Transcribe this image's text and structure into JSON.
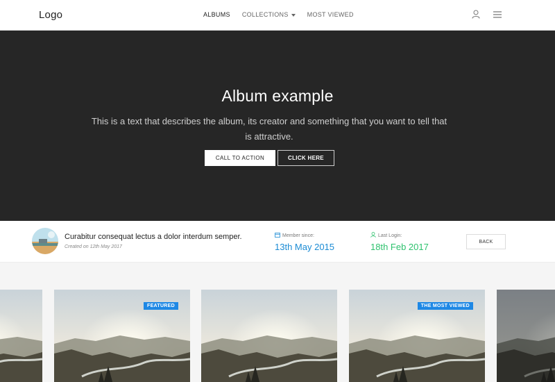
{
  "navbar": {
    "logo": "Logo",
    "links": [
      {
        "label": "ALBUMS"
      },
      {
        "label": "COLLECTIONS"
      },
      {
        "label": "MOST VIEWED"
      }
    ],
    "icons": [
      "user-icon",
      "menu-icon"
    ]
  },
  "hero": {
    "title": "Album example",
    "description": "This is a text that describes the album, its creator and something that you want to tell that is attractive.",
    "cta_label": "CALL TO ACTION",
    "click_label": "CLICK HERE"
  },
  "info": {
    "title": "Curabitur consequat lectus a dolor interdum semper.",
    "created": "Created on 12th May 2017",
    "member_label": "Member since:",
    "member_value": "13th May 2015",
    "login_label": "Last Login:",
    "login_value": "18th Feb 2017",
    "back_label": "BACK",
    "colors": {
      "member": "#1b8bd4",
      "login": "#2ec26e"
    }
  },
  "gallery": {
    "cards": [
      {
        "badge": ""
      },
      {
        "badge": "FEATURED"
      },
      {
        "badge": ""
      },
      {
        "badge": "THE MOST VIEWED"
      },
      {
        "badge": ""
      }
    ],
    "badge_color": "#1e88e5"
  }
}
